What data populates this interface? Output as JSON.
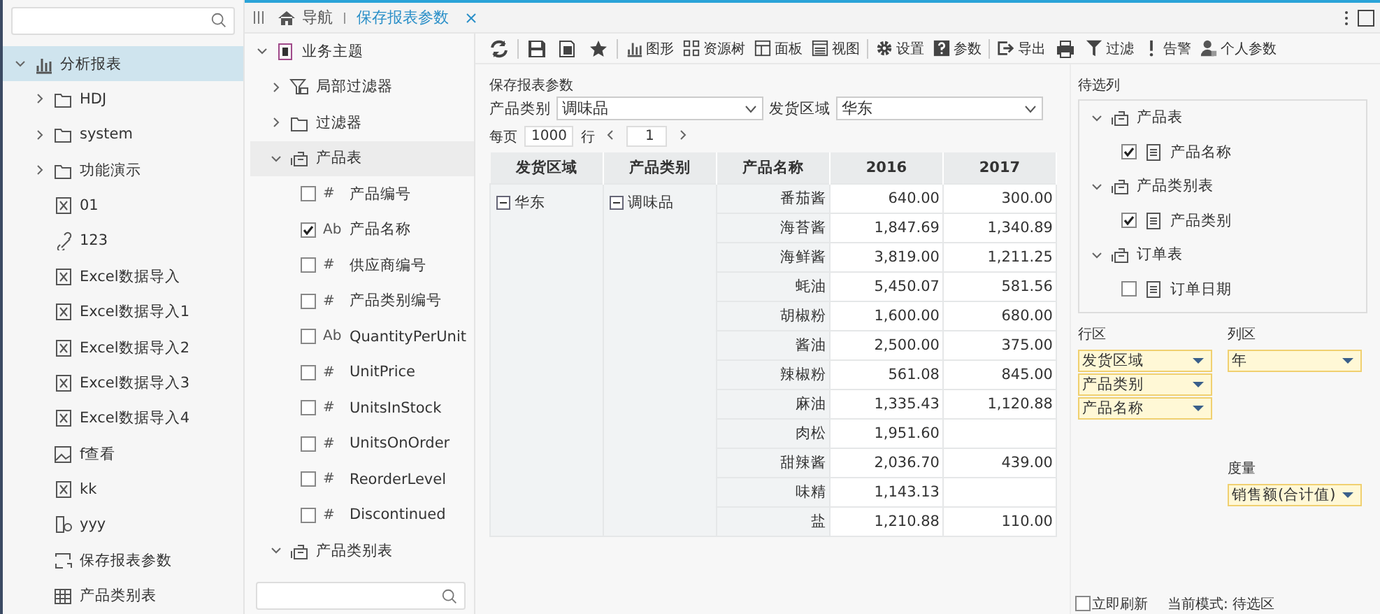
{
  "sidebar": {
    "tree": [
      {
        "label": "分析报表",
        "kind": "chart",
        "expanded": true,
        "selected": true,
        "children": [
          {
            "label": "HDJ",
            "kind": "folder",
            "expanded": false,
            "selected": false
          },
          {
            "label": "system",
            "kind": "folder",
            "expanded": false,
            "selected": false
          },
          {
            "label": "功能演示",
            "kind": "folder",
            "expanded": false,
            "selected": false
          },
          {
            "label": "01",
            "kind": "report",
            "selected": false
          },
          {
            "label": "123",
            "kind": "link",
            "selected": false
          },
          {
            "label": "Excel数据导入",
            "kind": "report",
            "selected": false
          },
          {
            "label": "Excel数据导入1",
            "kind": "report",
            "selected": false
          },
          {
            "label": "Excel数据导入2",
            "kind": "report",
            "selected": false
          },
          {
            "label": "Excel数据导入3",
            "kind": "report",
            "selected": false
          },
          {
            "label": "Excel数据导入4",
            "kind": "report",
            "selected": false
          },
          {
            "label": "f查看",
            "kind": "image",
            "selected": false
          },
          {
            "label": "kk",
            "kind": "report",
            "selected": false
          },
          {
            "label": "yyy",
            "kind": "mobile",
            "selected": false
          },
          {
            "label": "保存报表参数",
            "kind": "params",
            "selected": false
          },
          {
            "label": "产品类别表",
            "kind": "grid",
            "selected": false
          }
        ]
      }
    ]
  },
  "tabs": [
    {
      "label": "导航",
      "kind": "home",
      "selected": false
    },
    {
      "label": "保存报表参数",
      "kind": "doc",
      "selected": true,
      "closable": true
    }
  ],
  "resource_tree": {
    "items": [
      {
        "label": "业务主题",
        "kind": "theme",
        "expanded": true,
        "children": [
          {
            "label": "局部过滤器",
            "kind": "filter",
            "expanded": false,
            "selected": false
          },
          {
            "label": "过滤器",
            "kind": "folder",
            "expanded": false,
            "selected": false
          },
          {
            "label": "产品表",
            "kind": "table",
            "expanded": true,
            "selected": true,
            "children": [
              {
                "label": "产品编号",
                "type_glyph": "#",
                "checked": false
              },
              {
                "label": "产品名称",
                "type_glyph": "Ab",
                "checked": true
              },
              {
                "label": "供应商编号",
                "type_glyph": "#",
                "checked": false
              },
              {
                "label": "产品类别编号",
                "type_glyph": "#",
                "checked": false
              },
              {
                "label": "QuantityPerUnit",
                "type_glyph": "Ab",
                "checked": false
              },
              {
                "label": "UnitPrice",
                "type_glyph": "#",
                "checked": false
              },
              {
                "label": "UnitsInStock",
                "type_glyph": "#",
                "checked": false
              },
              {
                "label": "UnitsOnOrder",
                "type_glyph": "#",
                "checked": false
              },
              {
                "label": "ReorderLevel",
                "type_glyph": "#",
                "checked": false
              },
              {
                "label": "Discontinued",
                "type_glyph": "#",
                "checked": false
              }
            ]
          },
          {
            "label": "产品类别表",
            "kind": "table",
            "expanded": true,
            "selected": false
          }
        ]
      }
    ]
  },
  "toolbar": [
    [
      {
        "kind": "refresh"
      }
    ],
    [
      {
        "kind": "save"
      },
      {
        "kind": "save-as"
      },
      {
        "kind": "star"
      }
    ],
    [
      {
        "kind": "chart",
        "label": "图形"
      },
      {
        "kind": "tree",
        "label": "资源树"
      },
      {
        "kind": "panel",
        "label": "面板"
      },
      {
        "kind": "view",
        "label": "视图"
      }
    ],
    [
      {
        "kind": "gear",
        "label": "设置"
      },
      {
        "kind": "help",
        "label": "参数"
      }
    ],
    [
      {
        "kind": "export",
        "label": "导出"
      },
      {
        "kind": "print"
      },
      {
        "kind": "filter",
        "label": "过滤"
      },
      {
        "kind": "alert",
        "label": "告警"
      },
      {
        "kind": "user",
        "label": "个人参数"
      }
    ]
  ],
  "params": {
    "title": "保存报表参数",
    "fields": [
      {
        "label": "产品类别",
        "value": "调味品"
      },
      {
        "label": "发货区域",
        "value": "华东"
      }
    ]
  },
  "paging": {
    "per_page_label": "每页",
    "per_page": "1000",
    "unit": "行",
    "page": "1"
  },
  "table": {
    "columns": [
      "发货区域",
      "产品类别",
      "产品名称",
      "2016",
      "2017"
    ],
    "region": "华东",
    "category": "调味品",
    "rows": [
      {
        "product": "番茄酱",
        "v2016": "640.00",
        "v2017": "300.00"
      },
      {
        "product": "海苔酱",
        "v2016": "1,847.69",
        "v2017": "1,340.89"
      },
      {
        "product": "海鲜酱",
        "v2016": "3,819.00",
        "v2017": "1,211.25"
      },
      {
        "product": "蚝油",
        "v2016": "5,450.07",
        "v2017": "581.56"
      },
      {
        "product": "胡椒粉",
        "v2016": "1,600.00",
        "v2017": "680.00"
      },
      {
        "product": "酱油",
        "v2016": "2,500.00",
        "v2017": "375.00"
      },
      {
        "product": "辣椒粉",
        "v2016": "561.08",
        "v2017": "845.00"
      },
      {
        "product": "麻油",
        "v2016": "1,335.43",
        "v2017": "1,120.88"
      },
      {
        "product": "肉松",
        "v2016": "1,951.60",
        "v2017": null
      },
      {
        "product": "甜辣酱",
        "v2016": "2,036.70",
        "v2017": "439.00"
      },
      {
        "product": "味精",
        "v2016": "1,143.13",
        "v2017": null
      },
      {
        "product": "盐",
        "v2016": "1,210.88",
        "v2017": "110.00"
      }
    ]
  },
  "candidates": {
    "title": "待选列",
    "groups": [
      {
        "label": "产品表",
        "expanded": true,
        "fields": [
          {
            "label": "产品名称",
            "checked": true
          }
        ]
      },
      {
        "label": "产品类别表",
        "expanded": true,
        "fields": [
          {
            "label": "产品类别",
            "checked": true
          }
        ]
      },
      {
        "label": "订单表",
        "expanded": true,
        "fields": [
          {
            "label": "订单日期",
            "checked": false
          }
        ]
      }
    ]
  },
  "row_area": {
    "title": "行区",
    "items": [
      "发货区域",
      "产品类别",
      "产品名称"
    ]
  },
  "column_area": {
    "title": "列区",
    "items": [
      "年"
    ]
  },
  "measure_area": {
    "title": "度量",
    "items": [
      "销售额(合计值)"
    ]
  },
  "footer": {
    "auto_refresh": {
      "label": "立即刷新",
      "checked": false
    },
    "mode": "当前模式: 待选区"
  }
}
